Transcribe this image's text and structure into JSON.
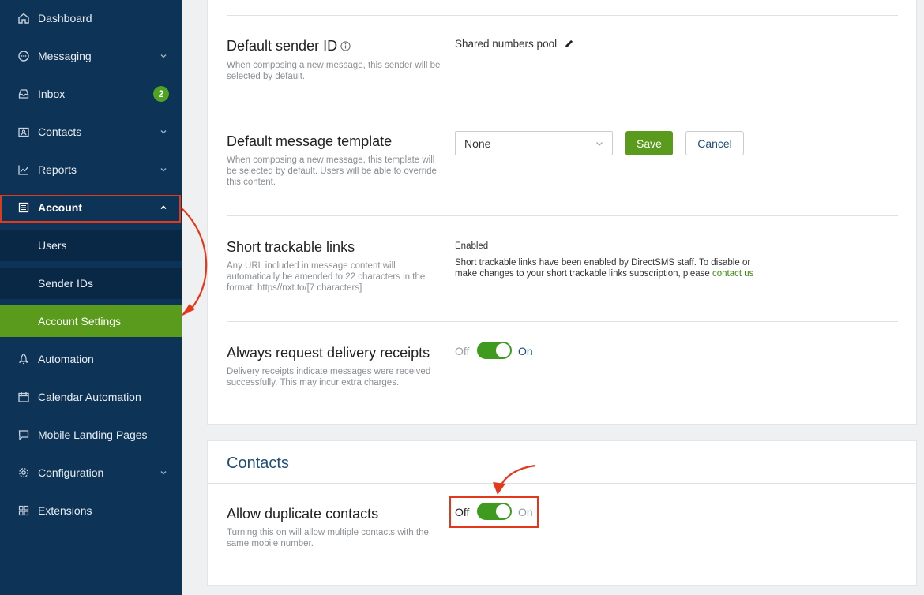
{
  "sidebar": {
    "items": [
      {
        "label": "Dashboard",
        "icon": "home-icon"
      },
      {
        "label": "Messaging",
        "icon": "chat-bubble-icon"
      },
      {
        "label": "Inbox",
        "icon": "inbox-icon",
        "badge": "2"
      },
      {
        "label": "Contacts",
        "icon": "contact-card-icon"
      },
      {
        "label": "Reports",
        "icon": "line-chart-icon"
      },
      {
        "label": "Account",
        "icon": "document-list-icon"
      },
      {
        "label": "Users"
      },
      {
        "label": "Sender IDs"
      },
      {
        "label": "Account Settings"
      },
      {
        "label": "Automation",
        "icon": "rocket-icon"
      },
      {
        "label": "Calendar Automation",
        "icon": "calendar-icon"
      },
      {
        "label": "Mobile Landing Pages",
        "icon": "chat-square-icon"
      },
      {
        "label": "Configuration",
        "icon": "gear-icon"
      },
      {
        "label": "Extensions",
        "icon": "grid-icon"
      }
    ]
  },
  "settings": {
    "sender": {
      "title": "Default sender ID",
      "desc": "When composing a new message, this sender will be selected by default.",
      "value": "Shared numbers pool"
    },
    "template": {
      "title": "Default message template",
      "desc": "When composing a new message, this template will be selected by default. Users will be able to override this content.",
      "selected": "None",
      "save_label": "Save",
      "cancel_label": "Cancel"
    },
    "links": {
      "title": "Short trackable links",
      "desc": "Any URL included in message content will automatically be amended to 22 characters in the format: https//nxt.to/[7 characters]",
      "status": "Enabled",
      "info": "Short trackable links have been enabled by DirectSMS staff. To disable or make changes to your short trackable links subscription, please",
      "link_text": "contact us"
    },
    "receipts": {
      "title": "Always request delivery receipts",
      "desc": "Delivery receipts indicate messages were received successfully. This may incur extra charges.",
      "off_label": "Off",
      "on_label": "On",
      "enabled": true
    }
  },
  "contacts": {
    "heading": "Contacts",
    "duplicate": {
      "title": "Allow duplicate contacts",
      "desc": "Turning this on will allow multiple contacts with the same mobile number.",
      "off_label": "Off",
      "on_label": "On",
      "enabled": true
    }
  },
  "colors": {
    "sidebar_bg": "#0d3357",
    "accent_green": "#5a9a1c",
    "highlight_red": "#e4381b",
    "heading_blue": "#1f4e79"
  }
}
